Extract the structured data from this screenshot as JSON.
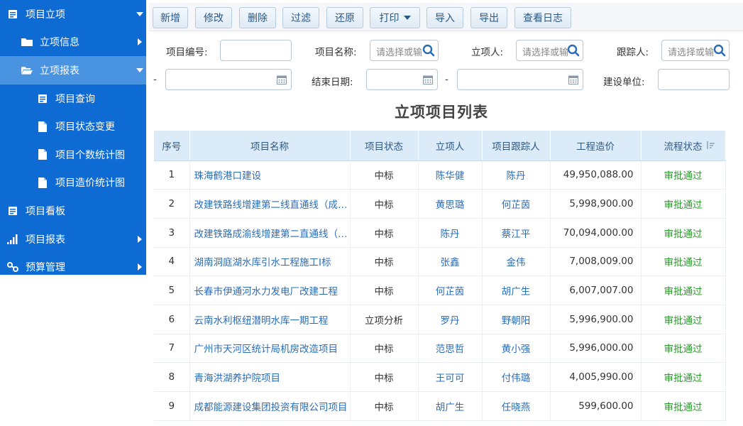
{
  "sidebar": {
    "items": [
      {
        "label": "项目立项",
        "icon": "list-icon"
      },
      {
        "label": "立项信息",
        "icon": "folder-icon"
      },
      {
        "label": "立项报表",
        "icon": "folder-open-icon"
      },
      {
        "label": "项目查询",
        "icon": "list-icon"
      },
      {
        "label": "项目状态变更",
        "icon": "document-icon"
      },
      {
        "label": "项目个数统计图",
        "icon": "document-icon"
      },
      {
        "label": "项目造价统计图",
        "icon": "document-icon"
      },
      {
        "label": "项目看板",
        "icon": "list-icon"
      },
      {
        "label": "项目报表",
        "icon": "bar-chart-icon"
      },
      {
        "label": "预算管理",
        "icon": "link-icon"
      }
    ]
  },
  "toolbar": {
    "add": "新增",
    "edit": "修改",
    "delete": "删除",
    "filter": "过滤",
    "restore": "还原",
    "print": "打印",
    "import": "导入",
    "export": "导出",
    "view_log": "查看日志"
  },
  "filters": {
    "project_no_label": "项目编号:",
    "project_name_label": "项目名称:",
    "project_name_placeholder": "请选择或输入",
    "creator_label": "立项人:",
    "creator_placeholder": "请选择或输入",
    "tracker_label": "跟踪人:",
    "tracker_placeholder": "请选择或输入",
    "dash1": "-",
    "end_date_label": "结束日期:",
    "dash2": "-",
    "unit_label": "建设单位:"
  },
  "list": {
    "title": "立项项目列表",
    "columns": [
      "序号",
      "项目名称",
      "项目状态",
      "立项人",
      "项目跟踪人",
      "工程造价",
      "流程状态"
    ],
    "rows": [
      {
        "no": "1",
        "name": "珠海鹤港口建设",
        "status": "中标",
        "creator": "陈华健",
        "tracker": "陈丹",
        "cost": "49,950,088.00",
        "flow": "审批通过"
      },
      {
        "no": "2",
        "name": "改建铁路线增建第二线直通线（成都-西安）",
        "status": "中标",
        "creator": "黄思璐",
        "tracker": "何芷茵",
        "cost": "5,998,900.00",
        "flow": "审批通过"
      },
      {
        "no": "3",
        "name": "改建铁路成渝线增建第二直通线（成渝）",
        "status": "中标",
        "creator": "陈丹",
        "tracker": "蔡江平",
        "cost": "70,094,000.00",
        "flow": "审批通过"
      },
      {
        "no": "4",
        "name": "湖南洞庭湖水库引水工程施工I标",
        "status": "中标",
        "creator": "张鑫",
        "tracker": "金伟",
        "cost": "7,008,009.00",
        "flow": "审批通过"
      },
      {
        "no": "5",
        "name": "长春市伊通河水力发电厂改建工程",
        "status": "中标",
        "creator": "何芷茵",
        "tracker": "胡广生",
        "cost": "6,007,007.00",
        "flow": "审批通过"
      },
      {
        "no": "6",
        "name": "云南水利枢纽潜明水库一期工程",
        "status": "立项分析",
        "creator": "罗丹",
        "tracker": "野朝阳",
        "cost": "5,996,900.00",
        "flow": "审批通过"
      },
      {
        "no": "7",
        "name": "广州市天河区统计局机房改造项目",
        "status": "中标",
        "creator": "范思哲",
        "tracker": "黄小强",
        "cost": "5,996,000.00",
        "flow": "审批通过"
      },
      {
        "no": "8",
        "name": "青海洪湖养护院项目",
        "status": "中标",
        "creator": "王可可",
        "tracker": "付伟璐",
        "cost": "4,005,990.00",
        "flow": "审批通过"
      },
      {
        "no": "9",
        "name": "成都能源建设集团投资有限公司项目",
        "status": "中标",
        "creator": "胡广生",
        "tracker": "任晓燕",
        "cost": "599,600.00",
        "flow": "审批通过"
      }
    ]
  }
}
